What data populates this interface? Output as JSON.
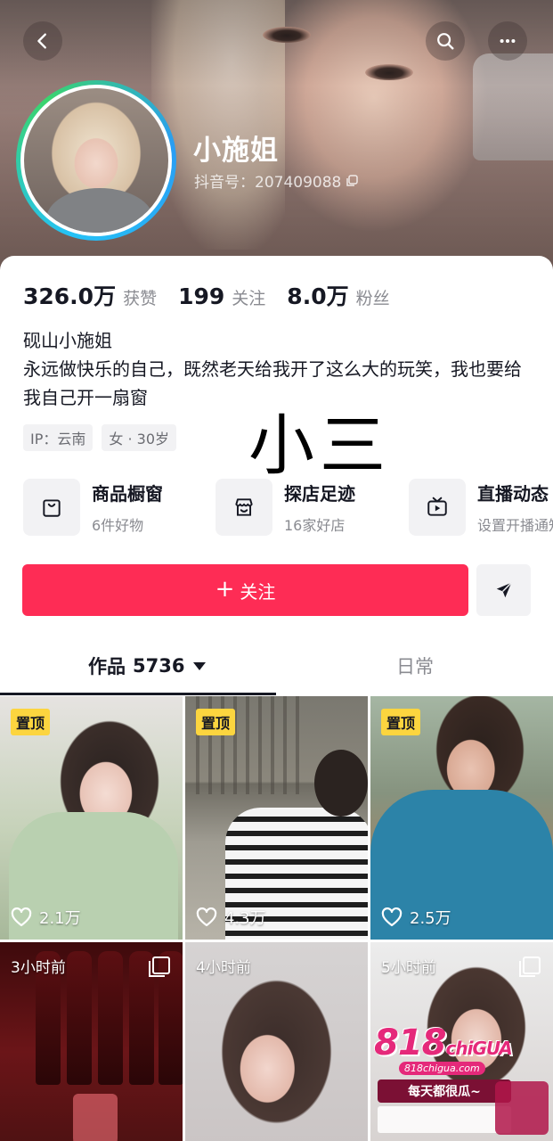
{
  "profile": {
    "name": "小施姐",
    "douyin_id": "抖音号：207409088"
  },
  "stats": [
    {
      "value": "326.0万",
      "label": "获赞"
    },
    {
      "value": "199",
      "label": "关注"
    },
    {
      "value": "8.0万",
      "label": "粉丝"
    }
  ],
  "bio": {
    "line1": "砚山小施姐",
    "line2": "永远做快乐的自己，既然老天给我开了这么大的玩笑，我也要给我自己开一扇窗"
  },
  "tags": [
    "IP：云南",
    "女 · 30岁"
  ],
  "overlay_text": "小三",
  "features": [
    {
      "title": "商品橱窗",
      "subtitle": "6件好物",
      "icon": "shopping-bag-icon"
    },
    {
      "title": "探店足迹",
      "subtitle": "16家好店",
      "icon": "store-icon"
    },
    {
      "title": "直播动态",
      "subtitle": "设置开播通知",
      "icon": "tv-icon"
    }
  ],
  "actions": {
    "follow_label": "关注",
    "share_icon": "send-icon"
  },
  "tabs": {
    "works_label": "作品",
    "works_count": "5736",
    "daily_label": "日常"
  },
  "videos": [
    {
      "badge": "置顶",
      "likes": "2.1万"
    },
    {
      "badge": "置顶",
      "likes": "4.3万"
    },
    {
      "badge": "置顶",
      "likes": "2.5万"
    },
    {
      "time": "3小时前"
    },
    {
      "time": "4小时前"
    },
    {
      "time": "5小时前"
    }
  ],
  "ad": {
    "logo_number": "818",
    "logo_text": "chiGUA",
    "url": "818chigua.com",
    "slogan": "每天都很瓜~"
  },
  "colors": {
    "follow_button": "#fe2c55",
    "pin_badge": "#fcd53f",
    "avatar_ring": [
      "#25c2f6",
      "#3bd46d"
    ]
  }
}
